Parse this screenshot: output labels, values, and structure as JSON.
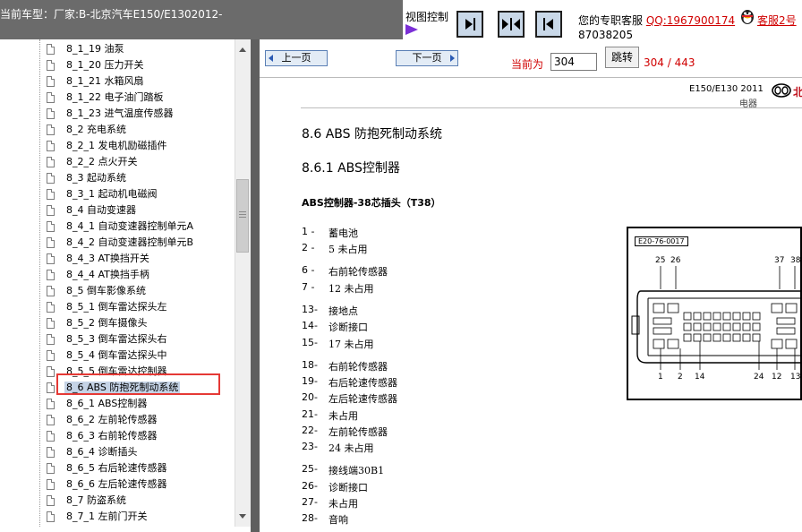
{
  "header": {
    "vehicle_model": "当前车型：厂家:B-北京汽车E150/E1302012-",
    "view_control_label": "视图控制",
    "support_text": "您的专职客服",
    "support_qq": "QQ:1967900174",
    "support_agent": "客服2号",
    "support_number": "87038205"
  },
  "tree": {
    "items": [
      {
        "label": "8_1_19 油泵"
      },
      {
        "label": "8_1_20 压力开关"
      },
      {
        "label": "8_1_21 水箱风扇"
      },
      {
        "label": "8_1_22 电子油门踏板"
      },
      {
        "label": "8_1_23 进气温度传感器"
      },
      {
        "label": "8_2 充电系统"
      },
      {
        "label": "8_2_1 发电机励磁插件"
      },
      {
        "label": "8_2_2 点火开关"
      },
      {
        "label": "8_3 起动系统"
      },
      {
        "label": "8_3_1 起动机电磁阀"
      },
      {
        "label": "8_4 自动变速器"
      },
      {
        "label": "8_4_1 自动变速器控制单元A"
      },
      {
        "label": "8_4_2 自动变速器控制单元B"
      },
      {
        "label": "8_4_3 AT换挡开关"
      },
      {
        "label": "8_4_4 AT换挡手柄"
      },
      {
        "label": "8_5 倒车影像系统"
      },
      {
        "label": "8_5_1 倒车雷达探头左"
      },
      {
        "label": "8_5_2 倒车摄像头"
      },
      {
        "label": "8_5_3 倒车雷达探头右"
      },
      {
        "label": "8_5_4 倒车雷达探头中"
      },
      {
        "label": "8_5_5 倒车雷达控制器"
      },
      {
        "label": "8_6 ABS 防抱死制动系统"
      },
      {
        "label": "8_6_1 ABS控制器"
      },
      {
        "label": "8_6_2 左前轮传感器"
      },
      {
        "label": "8_6_3 右前轮传感器"
      },
      {
        "label": "8_6_4 诊断插头"
      },
      {
        "label": "8_6_5 右后轮速传感器"
      },
      {
        "label": "8_6_6 左后轮速传感器"
      },
      {
        "label": "8_7 防盗系统"
      },
      {
        "label": "8_7_1 左前门开关"
      }
    ],
    "selected_index": 21
  },
  "nav": {
    "prev_label": "上一页",
    "next_label": "下一页",
    "current_page_label": "当前为",
    "current_page_value": "304",
    "jump_label": "跳转",
    "page_count": "304 / 443"
  },
  "document": {
    "header_model": "E150/E130 2011",
    "header_sub": "电器",
    "brand_text": "北",
    "section_title": "8.6 ABS 防抱死制动系统",
    "subsection_title": "8.6.1 ABS控制器",
    "connector_title": "ABS控制器-38芯插头（T38）",
    "pins": [
      {
        "num": "1 -",
        "desc": "蓄电池"
      },
      {
        "num": "2 -",
        "desc": "5 未占用"
      },
      {
        "num": "6 -",
        "desc": "右前轮传感器"
      },
      {
        "num": "7 -",
        "desc": "12 未占用"
      },
      {
        "num": "13-",
        "desc": "接地点"
      },
      {
        "num": "14-",
        "desc": "诊断接口"
      },
      {
        "num": "15-",
        "desc": "17 未占用"
      },
      {
        "num": "18-",
        "desc": "右前轮传感器"
      },
      {
        "num": "19-",
        "desc": "右后轮速传感器"
      },
      {
        "num": "20-",
        "desc": "左后轮速传感器"
      },
      {
        "num": "21-",
        "desc": "未占用"
      },
      {
        "num": "22-",
        "desc": "左前轮传感器"
      },
      {
        "num": "23-",
        "desc": "24 未占用"
      },
      {
        "num": "25-",
        "desc": "接线端30B1"
      },
      {
        "num": "26-",
        "desc": "诊断接口"
      },
      {
        "num": "27-",
        "desc": "未占用"
      },
      {
        "num": "28-",
        "desc": "音响"
      }
    ],
    "figure": {
      "id": "E20-76-0017",
      "top_labels": [
        "25",
        "26",
        "37",
        "38"
      ],
      "bottom_labels": [
        "1",
        "2",
        "14",
        "24",
        "12",
        "13"
      ]
    }
  },
  "icons": {
    "view_buttons": [
      "collapse-left-icon",
      "split-view-icon",
      "collapse-right-icon"
    ],
    "support": "qq-penguin-icon",
    "brand": "baic-logo-icon"
  },
  "colors": {
    "highlight_box": "#e53935",
    "red_text": "#d00000",
    "purple_arrow": "#7b2fd6",
    "topbar": "#6b6b6b",
    "nav_background": "#ffffff"
  }
}
